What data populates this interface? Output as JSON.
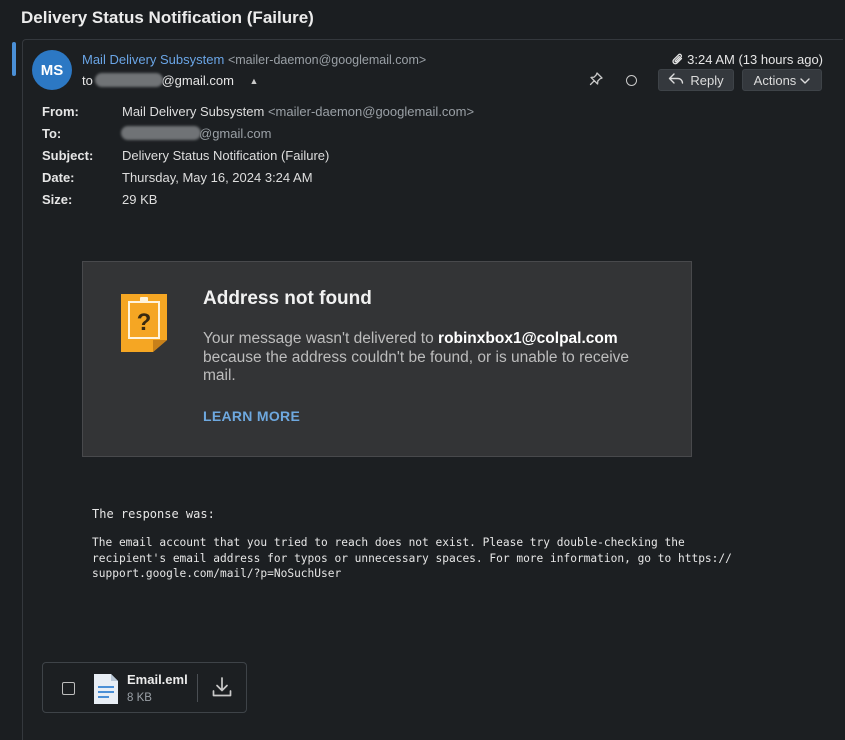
{
  "message": {
    "title": "Delivery Status Notification (Failure)",
    "avatar_initials": "MS",
    "sender_name": "Mail Delivery Subsystem",
    "sender_email": "<mailer-daemon@googlemail.com>",
    "to_prefix": "to",
    "to_suffix": "@gmail.com",
    "time": "3:24 AM (13 hours ago)",
    "reply_label": "Reply",
    "actions_label": "Actions"
  },
  "headers": {
    "from_label": "From:",
    "from_name": "Mail Delivery Subsystem",
    "from_email": "<mailer-daemon@googlemail.com>",
    "to_label": "To:",
    "to_suffix": "@gmail.com",
    "subject_label": "Subject:",
    "subject_value": "Delivery Status Notification (Failure)",
    "date_label": "Date:",
    "date_value": "Thursday, May 16, 2024 3:24 AM",
    "size_label": "Size:",
    "size_value": "29 KB"
  },
  "ndr": {
    "heading": "Address not found",
    "text_before": "Your message wasn't delivered to ",
    "address": "robinxbox1@colpal.com",
    "text_after": " because the address couldn't be found, or is unable to receive mail.",
    "learn_more": "LEARN MORE"
  },
  "response": {
    "label": "The response was:",
    "body": "The email account that you tried to reach does not exist. Please try double-checking the\nrecipient's email address for typos or unnecessary spaces. For more information, go to https://\nsupport.google.com/mail/?p=NoSuchUser"
  },
  "attachment": {
    "name": "Email.eml",
    "size": "8 KB"
  },
  "icons": {
    "attachment": "paperclip-icon",
    "pin": "pin-icon",
    "read_status": "circle-icon",
    "reply": "reply-arrow-icon",
    "actions": "chevron-down-icon",
    "warning": "warning-document-icon",
    "file": "document-file-icon",
    "download": "download-icon"
  },
  "colors": {
    "accent": "#4a8fd6",
    "avatar": "#2c78c4",
    "link": "#6ea8df",
    "warning": "#f5a623"
  }
}
